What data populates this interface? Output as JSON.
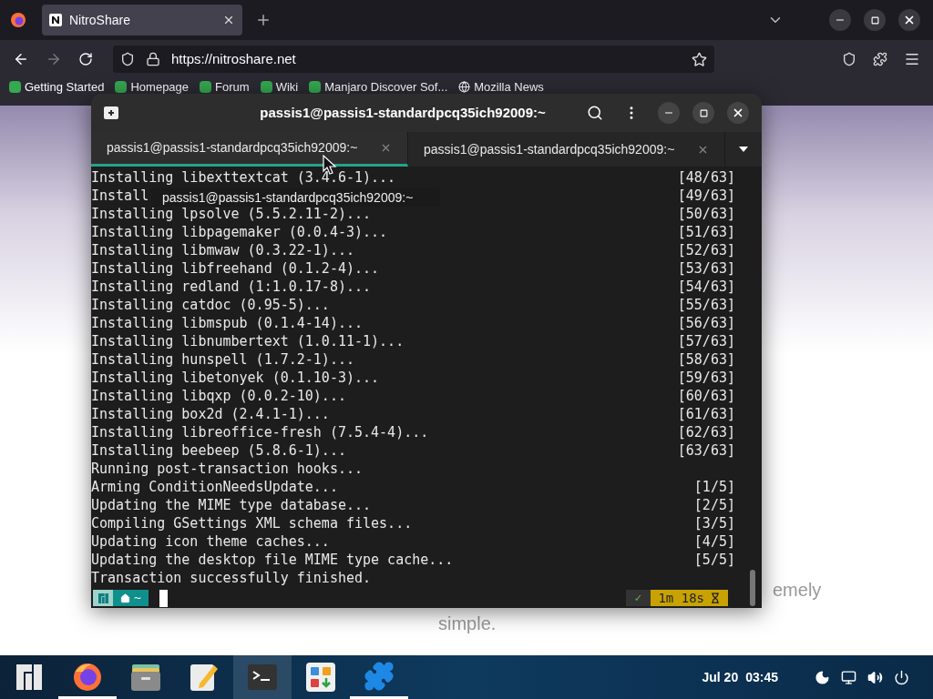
{
  "browser": {
    "tabs": [
      {
        "title": "NitroShare",
        "selected": true
      }
    ],
    "url": "https://nitroshare.net",
    "bookmarks": [
      {
        "label": "Getting Started"
      },
      {
        "label": "Homepage"
      },
      {
        "label": "Forum"
      },
      {
        "label": "Wiki"
      },
      {
        "label": "Manjaro Discover Sof..."
      },
      {
        "label": "Mozilla News"
      }
    ]
  },
  "page": {
    "texts": [
      "emely",
      "simple."
    ]
  },
  "terminal": {
    "title": "passis1@passis1-standardpcq35ich92009:~",
    "tabs": [
      {
        "label": "passis1@passis1-standardpcq35ich92009:~",
        "selected": true
      },
      {
        "label": "passis1@passis1-standardpcq35ich92009:~",
        "selected": false
      }
    ],
    "tooltip": "passis1@passis1-standardpcq35ich92009:~",
    "lines": [
      {
        "text": "Installing libexttextcat (3.4.6-1)...",
        "counter": "[48/63]"
      },
      {
        "text": "Install",
        "counter": "[49/63]"
      },
      {
        "text": "Installing lpsolve (5.5.2.11-2)...",
        "counter": "[50/63]"
      },
      {
        "text": "Installing libpagemaker (0.0.4-3)...",
        "counter": "[51/63]"
      },
      {
        "text": "Installing libmwaw (0.3.22-1)...",
        "counter": "[52/63]"
      },
      {
        "text": "Installing libfreehand (0.1.2-4)...",
        "counter": "[53/63]"
      },
      {
        "text": "Installing redland (1:1.0.17-8)...",
        "counter": "[54/63]"
      },
      {
        "text": "Installing catdoc (0.95-5)...",
        "counter": "[55/63]"
      },
      {
        "text": "Installing libmspub (0.1.4-14)...",
        "counter": "[56/63]"
      },
      {
        "text": "Installing libnumbertext (1.0.11-1)...",
        "counter": "[57/63]"
      },
      {
        "text": "Installing hunspell (1.7.2-1)...",
        "counter": "[58/63]"
      },
      {
        "text": "Installing libetonyek (0.1.10-3)...",
        "counter": "[59/63]"
      },
      {
        "text": "Installing libqxp (0.0.2-10)...",
        "counter": "[60/63]"
      },
      {
        "text": "Installing box2d (2.4.1-1)...",
        "counter": "[61/63]"
      },
      {
        "text": "Installing libreoffice-fresh (7.5.4-4)...",
        "counter": "[62/63]"
      },
      {
        "text": "Installing beebeep (5.8.6-1)...",
        "counter": "[63/63]"
      },
      {
        "text": "Running post-transaction hooks..."
      },
      {
        "text": "Arming ConditionNeedsUpdate...",
        "counter": "[1/5]"
      },
      {
        "text": "Updating the MIME type database...",
        "counter": "[2/5]"
      },
      {
        "text": "Compiling GSettings XML schema files...",
        "counter": "[3/5]"
      },
      {
        "text": "Updating icon theme caches...",
        "counter": "[4/5]"
      },
      {
        "text": "Updating the desktop file MIME type cache...",
        "counter": "[5/5]"
      },
      {
        "text": "Transaction successfully finished."
      }
    ],
    "prompt": {
      "dir": "~",
      "status": "✓",
      "duration": "1m 18s"
    }
  },
  "taskbar": {
    "apps": [
      {
        "kind": "menu",
        "running": false,
        "active": false
      },
      {
        "kind": "firefox",
        "running": true,
        "active": false
      },
      {
        "kind": "files",
        "running": false,
        "active": false
      },
      {
        "kind": "editor",
        "running": false,
        "active": false
      },
      {
        "kind": "terminal",
        "running": false,
        "active": true
      },
      {
        "kind": "software",
        "running": false,
        "active": false
      },
      {
        "kind": "puzzle",
        "running": true,
        "active": false
      }
    ],
    "date": "Jul 20",
    "time": "03:45"
  }
}
